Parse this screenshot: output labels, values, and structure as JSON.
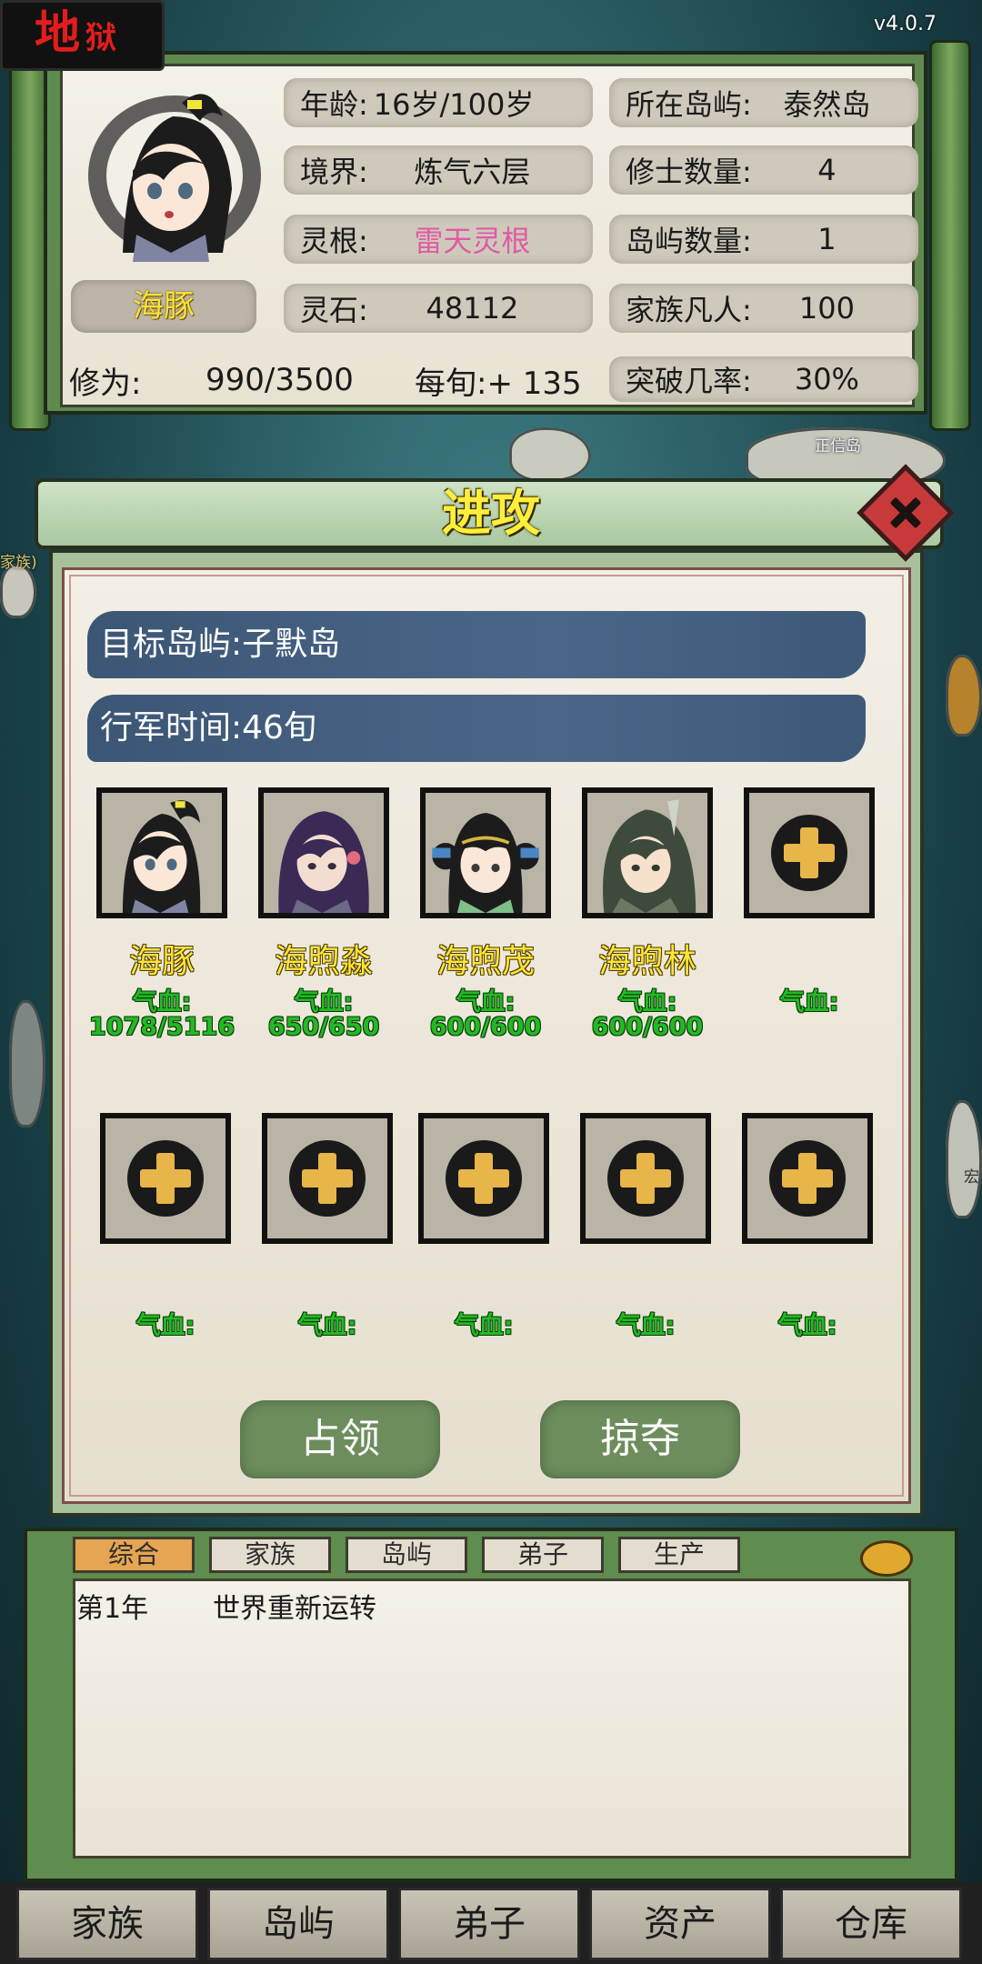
{
  "header": {
    "difficulty_main": "地",
    "difficulty_sub": "狱",
    "version": "v4.0.7"
  },
  "player": {
    "name": "海豚",
    "age_label": "年龄:",
    "age_value": "16岁/100岁",
    "realm_label": "境界:",
    "realm_value": "炼气六层",
    "root_label": "灵根:",
    "root_value": "雷天灵根",
    "stone_label": "灵石:",
    "stone_value": "48112",
    "island_label": "所在岛屿:",
    "island_value": "泰然岛",
    "cultivators_label": "修士数量:",
    "cultivators_value": "4",
    "islands_label": "岛屿数量:",
    "islands_value": "1",
    "mortals_label": "家族凡人:",
    "mortals_value": "100",
    "cultivation_label": "修为:",
    "cultivation_value": "990/3500",
    "per_turn": "每旬:+ 135",
    "breakthrough_label": "突破几率:",
    "breakthrough_value": "30%"
  },
  "map": {
    "label_1": "正信岛",
    "label_2": "家族)",
    "label_3": "宏"
  },
  "attack": {
    "title": "进攻",
    "target": "目标岛屿:子默岛",
    "march_time": "行军时间:46旬",
    "hp_label": "气血:",
    "members": [
      {
        "name": "海豚",
        "hp": "1078/5116"
      },
      {
        "name": "海煦淼",
        "hp": "650/650"
      },
      {
        "name": "海煦茂",
        "hp": "600/600"
      },
      {
        "name": "海煦林",
        "hp": "600/600"
      }
    ],
    "occupy_button": "占领",
    "plunder_button": "掠夺"
  },
  "log": {
    "tabs": [
      "综合",
      "家族",
      "岛屿",
      "弟子",
      "生产"
    ],
    "active_tab": 0,
    "entries": [
      {
        "year": "第1年",
        "text": "世界重新运转"
      }
    ]
  },
  "nav": {
    "items": [
      "家族",
      "岛屿",
      "弟子",
      "资产",
      "仓库"
    ]
  },
  "colors": {
    "hp_green": "#24b824",
    "name_yellow": "#ffe33a",
    "root_pink": "#e05aa4",
    "ink_blue": "#4a6688",
    "frame_green": "#5e8a4f"
  }
}
